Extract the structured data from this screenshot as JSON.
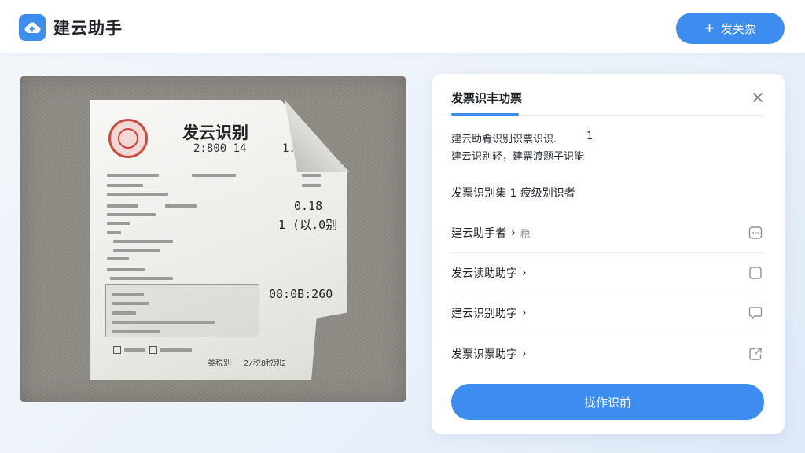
{
  "app": {
    "brand": "建云助手",
    "new_button_label": "发关票",
    "accent_color": "#3d8cf0"
  },
  "receipt": {
    "title": "发云识别",
    "number": "2:800 14",
    "corner": "1...",
    "value1": "0.18",
    "value2": "1 (以.0别",
    "value3": "08:0B:260",
    "footer_left": "类税别",
    "footer_right": "2/税8税别2"
  },
  "panel": {
    "title": "发票识丰功票",
    "desc_line1": "建云助肴识别识票识识.",
    "desc_line1_num": "1",
    "desc_line2": "建云识别轻，建票渡题子识能",
    "section": "发票识别集 1 疲级别识者",
    "rows": [
      {
        "label": "建云助手者",
        "sub": "稳",
        "icon": "chat-square-icon"
      },
      {
        "label": "发云读助助字",
        "sub": "",
        "icon": "square-icon"
      },
      {
        "label": "建云识别助字",
        "sub": "",
        "icon": "message-icon"
      },
      {
        "label": "发票识票助字",
        "sub": "",
        "icon": "share-square-icon"
      }
    ],
    "primary_button": "拢作识前"
  }
}
